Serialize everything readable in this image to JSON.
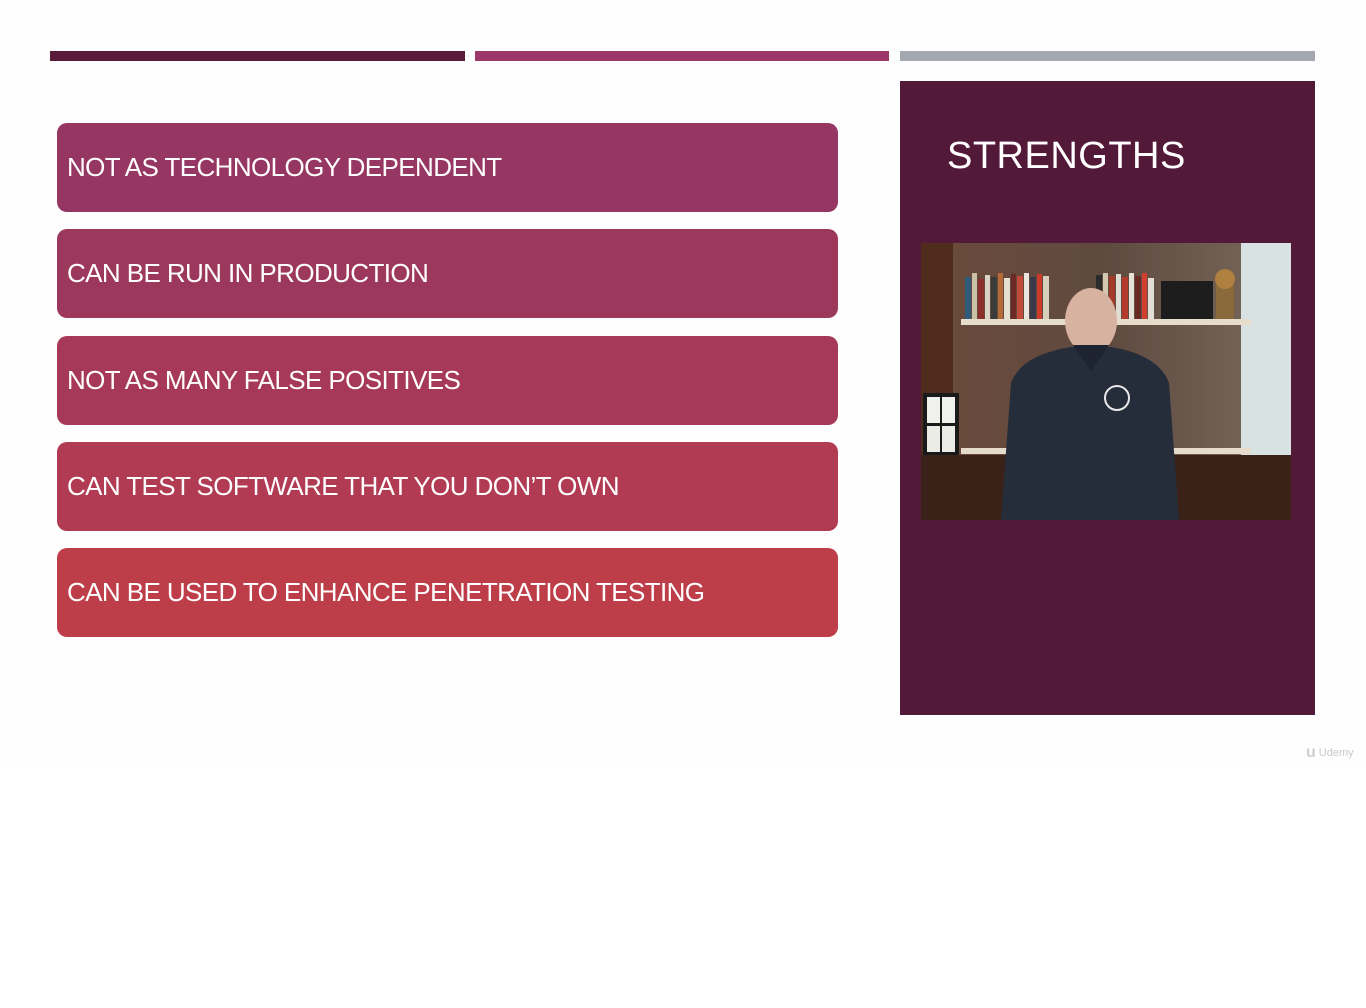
{
  "slide": {
    "top_bars": [
      {
        "color": "#5a1a3a"
      },
      {
        "color": "#9b3868"
      },
      {
        "color": "#a2a8ae"
      }
    ],
    "bullets": [
      {
        "text": "NOT AS TECHNOLOGY DEPENDENT",
        "color": "#963763"
      },
      {
        "text": "CAN BE RUN IN PRODUCTION",
        "color": "#9d385d"
      },
      {
        "text": "NOT AS MANY FALSE POSITIVES",
        "color": "#a63959"
      },
      {
        "text": "CAN TEST SOFTWARE THAT YOU DON’T OWN",
        "color": "#b03b52"
      },
      {
        "text": "CAN BE USED TO ENHANCE PENETRATION TESTING",
        "color": "#bd3d49"
      }
    ],
    "panel": {
      "title": "STRENGTHS",
      "color": "#531938",
      "video_label": "presenter-video"
    },
    "watermark": {
      "logo": "u",
      "text": "Udemy"
    }
  }
}
